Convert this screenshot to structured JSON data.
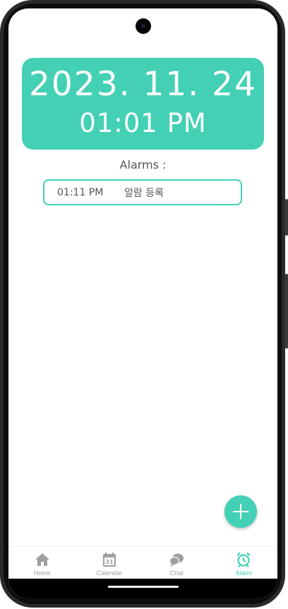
{
  "header": {
    "date": "2023. 11. 24",
    "time": "01:01 PM"
  },
  "alarms": {
    "heading": "Alarms :",
    "items": [
      {
        "time": "01:11 PM",
        "label": "알람 등록"
      }
    ]
  },
  "fab": {
    "icon": "plus-icon"
  },
  "bottom_nav": {
    "items": [
      {
        "label": "Home",
        "icon": "home-icon",
        "active": false
      },
      {
        "label": "Calendar",
        "icon": "calendar-icon",
        "active": false,
        "icon_text": "31"
      },
      {
        "label": "Chat",
        "icon": "chat-icon",
        "active": false
      },
      {
        "label": "Alarm",
        "icon": "alarm-icon",
        "active": true
      }
    ]
  },
  "colors": {
    "accent": "#44d0b5",
    "inactive": "#9e9e9e",
    "text": "#555555"
  }
}
